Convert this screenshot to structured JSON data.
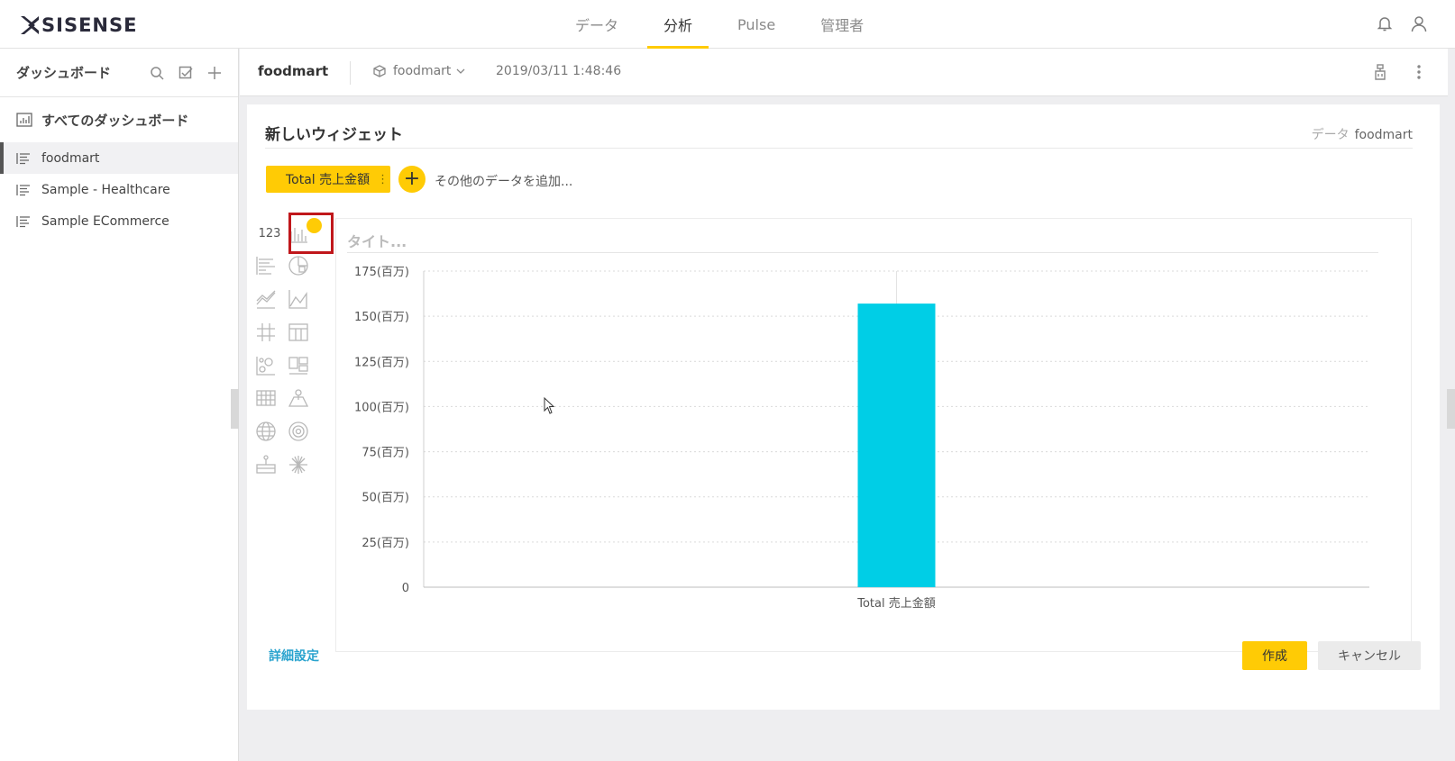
{
  "app": {
    "logo_text": "SISENSE",
    "nav": [
      {
        "label": "データ",
        "active": false
      },
      {
        "label": "分析",
        "active": true
      },
      {
        "label": "Pulse",
        "active": false
      },
      {
        "label": "管理者",
        "active": false
      }
    ]
  },
  "sidebar": {
    "title": "ダッシュボード",
    "all_label": "すべてのダッシュボード",
    "items": [
      {
        "label": "foodmart",
        "active": true
      },
      {
        "label": "Sample - Healthcare",
        "active": false
      },
      {
        "label": "Sample ECommerce",
        "active": false
      }
    ]
  },
  "dashboard": {
    "title": "foodmart",
    "source": "foodmart",
    "timestamp": "2019/03/11 1:48:46"
  },
  "editor": {
    "title": "新しいウィジェット",
    "data_label": "データ",
    "data_source": "foodmart",
    "value_pill": "Total 売上金額",
    "add_more": "その他のデータを追加...",
    "number_type": "123",
    "title_placeholder": "タイト...",
    "advanced": "詳細設定",
    "create": "作成",
    "cancel": "キャンセル"
  },
  "chart_data": {
    "type": "bar",
    "categories": [
      "Total 売上金額"
    ],
    "values": [
      157
    ],
    "ylim": [
      0,
      175
    ],
    "yticks": [
      {
        "v": 0,
        "label": "0"
      },
      {
        "v": 25,
        "label": "25(百万)"
      },
      {
        "v": 50,
        "label": "50(百万)"
      },
      {
        "v": 75,
        "label": "75(百万)"
      },
      {
        "v": 100,
        "label": "100(百万)"
      },
      {
        "v": 125,
        "label": "125(百万)"
      },
      {
        "v": 150,
        "label": "150(百万)"
      },
      {
        "v": 175,
        "label": "175(百万)"
      }
    ],
    "bar_color": "#00cee6",
    "grid": true
  },
  "colors": {
    "accent": "#ffcb05",
    "selection": "#c0171b",
    "link": "#29a3ce"
  }
}
